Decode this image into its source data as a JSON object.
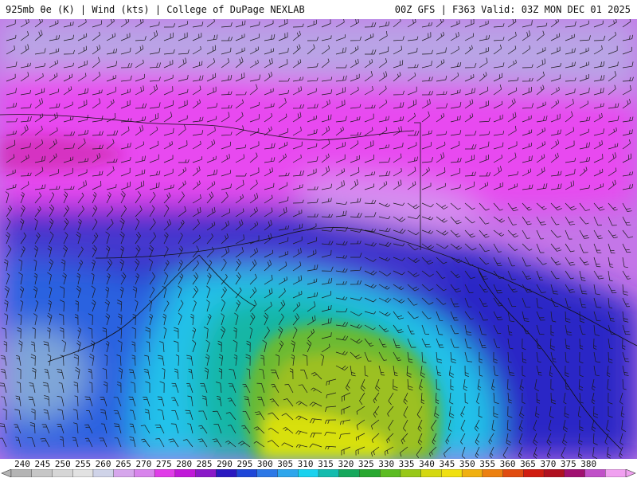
{
  "header": {
    "left_text": "925mb θe (K) | Wind (kts) | College of DuPage NEXLAB",
    "right_text": "00Z GFS | F363 Valid: 03Z MON DEC 01 2025"
  },
  "map": {
    "variable": "925mb equivalent potential temperature (K)",
    "overlay": "Wind barbs (kts)"
  },
  "legend": {
    "unit": "K",
    "values": [
      240,
      245,
      250,
      255,
      260,
      265,
      270,
      275,
      280,
      285,
      290,
      295,
      300,
      305,
      310,
      315,
      320,
      325,
      330,
      335,
      340,
      345,
      350,
      355,
      360,
      365,
      370,
      375,
      380
    ],
    "labels": [
      "240",
      "245",
      "250",
      "255",
      "260",
      "265",
      "270",
      "275",
      "280",
      "285",
      "290",
      "295",
      "300",
      "305",
      "310",
      "315",
      "320",
      "325",
      "330",
      "335",
      "340",
      "345",
      "350",
      "355",
      "360",
      "365",
      "370",
      "375",
      "380"
    ],
    "colors": [
      "#b4b4b4",
      "#c6c6c6",
      "#d6d6d6",
      "#e2e2e2",
      "#cfd3e8",
      "#d6a6ec",
      "#d884ec",
      "#e03ce8",
      "#c018d8",
      "#8a18c8",
      "#2a18c0",
      "#1e46d8",
      "#2c78e6",
      "#2ea6ec",
      "#1ad2ee",
      "#14bcae",
      "#16a85c",
      "#28a830",
      "#5cbc22",
      "#98c818",
      "#d4d810",
      "#f0e010",
      "#f0b010",
      "#ec8010",
      "#e04c10",
      "#d01c10",
      "#b01020",
      "#a01070",
      "#c050c8",
      "#f0a0f0"
    ]
  }
}
